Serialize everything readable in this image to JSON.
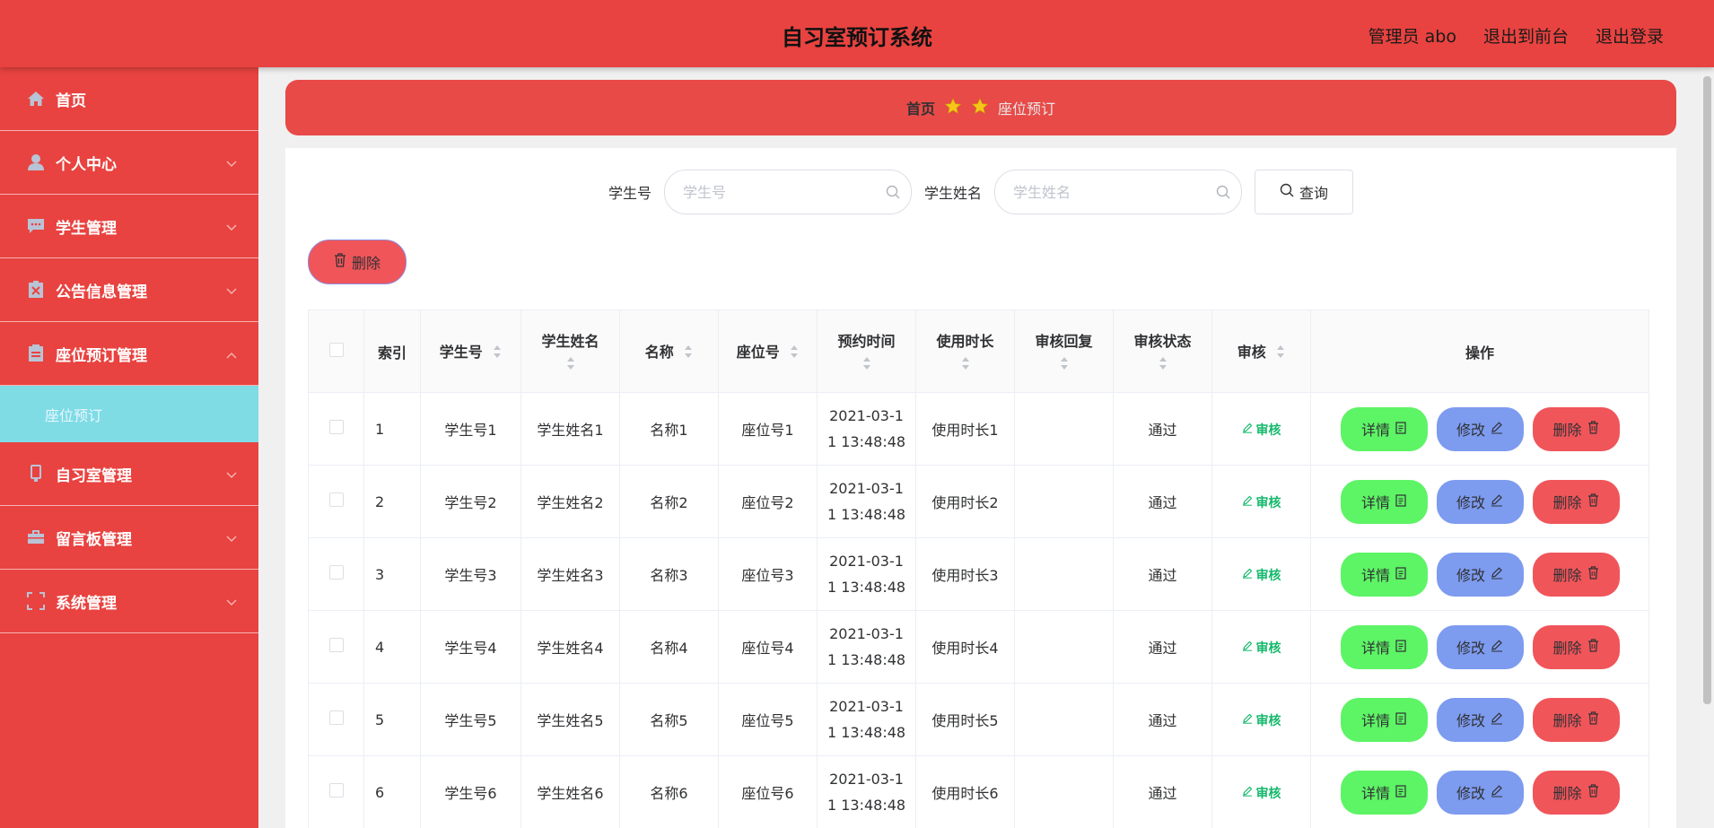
{
  "header": {
    "title": "自习室预订系统",
    "admin": "管理员 abo",
    "to_front": "退出到前台",
    "logout": "退出登录"
  },
  "sidebar": {
    "items": [
      {
        "label": "首页",
        "icon": "home-icon"
      },
      {
        "label": "个人中心",
        "icon": "user-icon"
      },
      {
        "label": "学生管理",
        "icon": "chat-icon"
      },
      {
        "label": "公告信息管理",
        "icon": "notice-icon"
      },
      {
        "label": "座位预订管理",
        "icon": "clipboard-icon",
        "expanded": true
      },
      {
        "label": "自习室管理",
        "icon": "phone-icon"
      },
      {
        "label": "留言板管理",
        "icon": "briefcase-icon"
      },
      {
        "label": "系统管理",
        "icon": "frame-icon"
      }
    ],
    "active_sub": "座位预订"
  },
  "breadcrumb": {
    "home": "首页",
    "current": "座位预订"
  },
  "search": {
    "student_no_label": "学生号",
    "student_no_placeholder": "学生号",
    "student_name_label": "学生姓名",
    "student_name_placeholder": "学生姓名",
    "query_label": "查询"
  },
  "batch_delete_label": "删除",
  "table": {
    "headers": {
      "index": "索引",
      "student_no": "学生号",
      "student_name": "学生姓名",
      "name": "名称",
      "seat_no": "座位号",
      "reserve_time": "预约时间",
      "duration": "使用时长",
      "review_reply": "审核回复",
      "review_status": "审核状态",
      "review": "审核",
      "actions": "操作"
    },
    "rows": [
      {
        "index": "1",
        "student_no": "学生号1",
        "student_name": "学生姓名1",
        "name": "名称1",
        "seat_no": "座位号1",
        "time_a": "2021-03-1",
        "time_b": "1 13:48:48",
        "duration": "使用时长1",
        "reply": "",
        "status": "通过",
        "review": "审核"
      },
      {
        "index": "2",
        "student_no": "学生号2",
        "student_name": "学生姓名2",
        "name": "名称2",
        "seat_no": "座位号2",
        "time_a": "2021-03-1",
        "time_b": "1 13:48:48",
        "duration": "使用时长2",
        "reply": "",
        "status": "通过",
        "review": "审核"
      },
      {
        "index": "3",
        "student_no": "学生号3",
        "student_name": "学生姓名3",
        "name": "名称3",
        "seat_no": "座位号3",
        "time_a": "2021-03-1",
        "time_b": "1 13:48:48",
        "duration": "使用时长3",
        "reply": "",
        "status": "通过",
        "review": "审核"
      },
      {
        "index": "4",
        "student_no": "学生号4",
        "student_name": "学生姓名4",
        "name": "名称4",
        "seat_no": "座位号4",
        "time_a": "2021-03-1",
        "time_b": "1 13:48:48",
        "duration": "使用时长4",
        "reply": "",
        "status": "通过",
        "review": "审核"
      },
      {
        "index": "5",
        "student_no": "学生号5",
        "student_name": "学生姓名5",
        "name": "名称5",
        "seat_no": "座位号5",
        "time_a": "2021-03-1",
        "time_b": "1 13:48:48",
        "duration": "使用时长5",
        "reply": "",
        "status": "通过",
        "review": "审核"
      },
      {
        "index": "6",
        "student_no": "学生号6",
        "student_name": "学生姓名6",
        "name": "名称6",
        "seat_no": "座位号6",
        "time_a": "2021-03-1",
        "time_b": "1 13:48:48",
        "duration": "使用时长6",
        "reply": "",
        "status": "通过",
        "review": "审核"
      }
    ],
    "actions": {
      "detail": "详情",
      "edit": "修改",
      "delete": "删除"
    }
  },
  "colors": {
    "brand_red": "#e84340",
    "submenu_active": "#7fdbe4",
    "detail_green": "#5df466",
    "edit_blue": "#7d9bef",
    "delete_red": "#f0555a",
    "audit_green": "#14b86b"
  }
}
